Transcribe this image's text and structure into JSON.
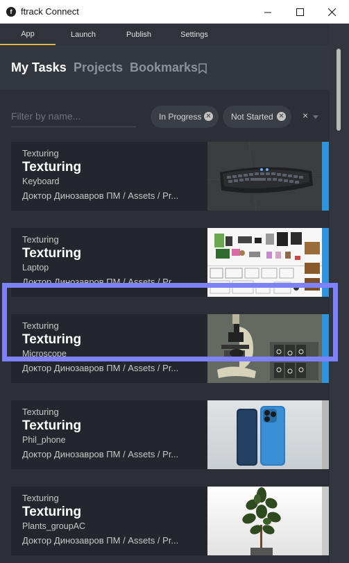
{
  "window": {
    "title": "ftrack Connect",
    "app_icon_letter": "f"
  },
  "nav": {
    "tabs": [
      {
        "label": "App",
        "active": true
      },
      {
        "label": "Launch",
        "active": false
      },
      {
        "label": "Publish",
        "active": false
      },
      {
        "label": "Settings",
        "active": false
      }
    ]
  },
  "sections": {
    "my_tasks": "My Tasks",
    "projects": "Projects",
    "bookmarks": "Bookmarks"
  },
  "filter": {
    "placeholder": "Filter by name...",
    "chips": [
      "In Progress",
      "Not Started"
    ],
    "clear_symbol": "×"
  },
  "tasks": [
    {
      "type": "Texturing",
      "name": "Texturing",
      "object": "Keyboard",
      "path": "Доктор Динозавров ПМ / Assets / Pr...",
      "thumbnail": "keyboard",
      "status_color": "#2f94dc"
    },
    {
      "type": "Texturing",
      "name": "Texturing",
      "object": "Laptop",
      "path": "Доктор Динозавров ПМ / Assets / Pr...",
      "thumbnail": "laptop-reference-sheet",
      "status_color": "#2f94dc"
    },
    {
      "type": "Texturing",
      "name": "Texturing",
      "object": "Microscope",
      "path": "Доктор Динозавров ПМ / Assets / Pr...",
      "thumbnail": "microscope",
      "status_color": "#2f94dc"
    },
    {
      "type": "Texturing",
      "name": "Texturing",
      "object": "Phil_phone",
      "path": "Доктор Динозавров ПМ / Assets / Pr...",
      "thumbnail": "phone",
      "status_color": "#b8b8b8"
    },
    {
      "type": "Texturing",
      "name": "Texturing",
      "object": "Plants_groupAC",
      "path": "Доктор Динозавров ПМ / Assets / Pr...",
      "thumbnail": "plant",
      "status_color": "#c9c9c9"
    }
  ],
  "colors": {
    "accent_tab": "#e7b04b",
    "selection": "#7f82ff"
  }
}
